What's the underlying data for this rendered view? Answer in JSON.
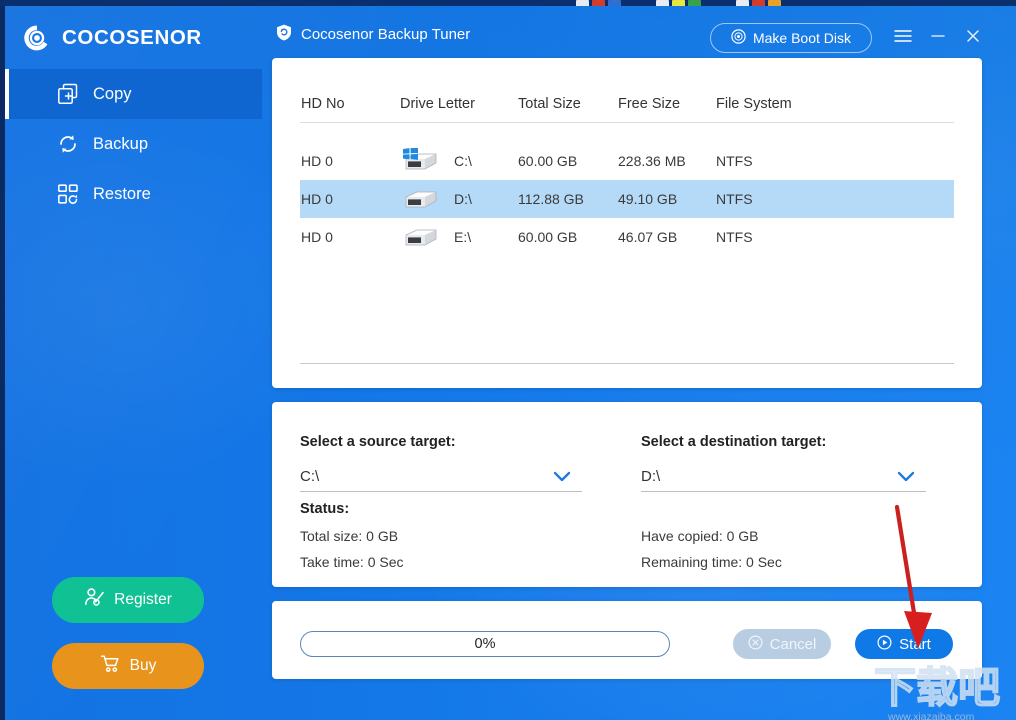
{
  "app": {
    "brand": "COCOSENOR",
    "logo_icon": "cocosenor-logo-icon",
    "window_title": "Cocosenor Backup Tuner",
    "title_icon": "shield-backup-icon",
    "accent_blue": "#1478e8",
    "panel_blue": "#0f66d0",
    "card_white": "#ffffff"
  },
  "header": {
    "make_boot_disk_label": "Make Boot Disk",
    "make_boot_disk_icon": "disc-icon",
    "menu_icon": "hamburger-menu-icon",
    "minimize_icon": "minimize-icon",
    "close_icon": "close-icon"
  },
  "sidebar": {
    "items": [
      {
        "label": "Copy",
        "icon": "copy-icon",
        "active": true
      },
      {
        "label": "Backup",
        "icon": "refresh-backup-icon",
        "active": false
      },
      {
        "label": "Restore",
        "icon": "restore-grid-icon",
        "active": false
      }
    ],
    "register": {
      "label": "Register",
      "icon": "user-add-icon",
      "color": "#10c194"
    },
    "buy": {
      "label": "Buy",
      "icon": "cart-icon",
      "color": "#e8941c"
    }
  },
  "drive_table": {
    "columns": [
      "HD No",
      "Drive Letter",
      "Total Size",
      "Free Size",
      "File System"
    ],
    "rows": [
      {
        "hd_no": "HD 0",
        "drive_letter": "C:\\",
        "total_size": "60.00 GB",
        "free_size": "228.36 MB",
        "file_system": "NTFS",
        "icon": "hard-drive-windows-icon",
        "selected": false
      },
      {
        "hd_no": "HD 0",
        "drive_letter": "D:\\",
        "total_size": "112.88 GB",
        "free_size": "49.10 GB",
        "file_system": "NTFS",
        "icon": "hard-drive-icon",
        "selected": true
      },
      {
        "hd_no": "HD 0",
        "drive_letter": "E:\\",
        "total_size": "60.00 GB",
        "free_size": "46.07 GB",
        "file_system": "NTFS",
        "icon": "hard-drive-icon",
        "selected": false
      }
    ]
  },
  "select_panel": {
    "source": {
      "label": "Select a source target:",
      "value": "C:\\",
      "chevron_icon": "chevron-down-icon"
    },
    "destination": {
      "label": "Select a destination target:",
      "value": "D:\\",
      "chevron_icon": "chevron-down-icon"
    },
    "status_label": "Status:",
    "stats": {
      "total_size": "Total size:  0 GB",
      "take_time": "Take time:  0 Sec",
      "have_copied": "Have  copied:  0 GB",
      "remaining_time": "Remaining time:  0 Sec"
    }
  },
  "actions": {
    "progress_text": "0%",
    "progress_percent": 0,
    "cancel_label": "Cancel",
    "cancel_icon": "cancel-circle-icon",
    "start_label": "Start",
    "start_icon": "play-circle-icon"
  },
  "annotation": {
    "arrow_icon": "red-arrow-pointing-down",
    "arrow_color": "#cc2020",
    "target": "Start"
  },
  "watermark": {
    "mark": "下载吧",
    "url": "www.xiazaiba.com"
  }
}
